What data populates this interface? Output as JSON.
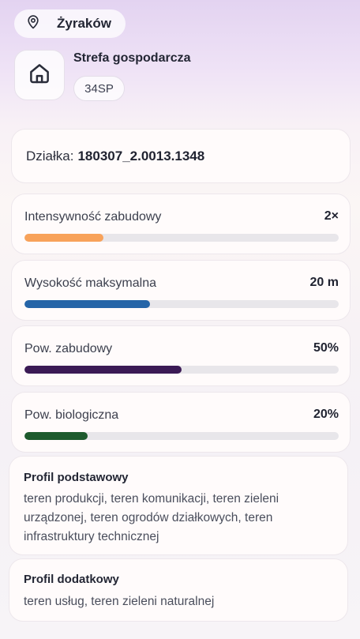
{
  "location": {
    "icon": "map-pin-icon",
    "name": "Żyraków"
  },
  "zone": {
    "icon": "home-icon",
    "title": "Strefa gospodarcza",
    "code": "34SP"
  },
  "parcel": {
    "label": "Działka:",
    "number": "180307_2.0013.1348"
  },
  "metrics": [
    {
      "label": "Intensywność zabudowy",
      "value": "2×",
      "fill_fraction": 0.25,
      "color": "#f8a25a"
    },
    {
      "label": "Wysokość maksymalna",
      "value": "20 m",
      "fill_fraction": 0.4,
      "color": "#2565a8"
    },
    {
      "label": "Pow. zabudowy",
      "value": "50%",
      "fill_fraction": 0.5,
      "color": "#3b1a55"
    },
    {
      "label": "Pow. biologiczna",
      "value": "20%",
      "fill_fraction": 0.2,
      "color": "#1d5a2d"
    }
  ],
  "profiles": [
    {
      "title": "Profil podstawowy",
      "text": "teren produkcji, teren komunikacji, teren zieleni urządzonej, teren ogrodów działkowych, teren infrastruktury technicznej"
    },
    {
      "title": "Profil dodatkowy",
      "text": "teren usług, teren zieleni naturalnej"
    }
  ]
}
